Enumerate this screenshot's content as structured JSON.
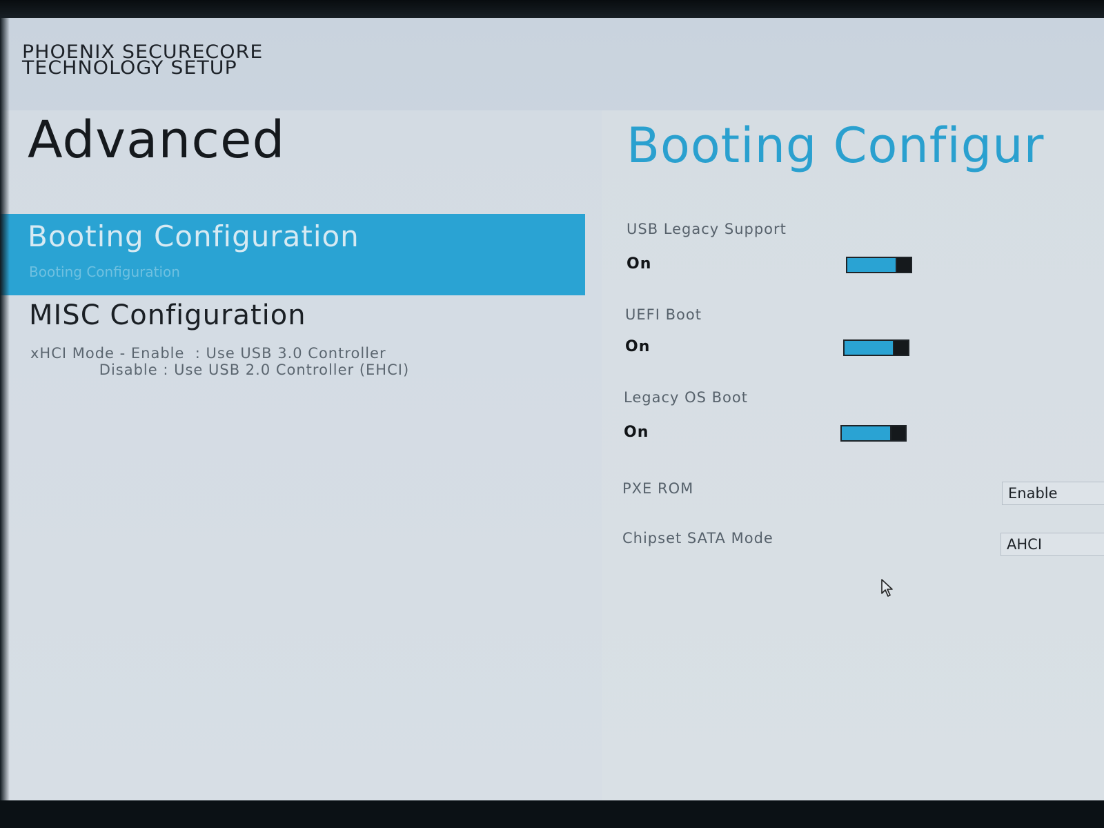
{
  "brand": {
    "line1": "PHOENIX SECURECORE",
    "line2": "TECHNOLOGY SETUP"
  },
  "page": {
    "title": "Advanced"
  },
  "nav": {
    "items": [
      {
        "label": "Booting Configuration",
        "sub": "Booting Configuration",
        "selected": true
      },
      {
        "label": "MISC Configuration",
        "desc_line1": "xHCI Mode - Enable  : Use USB 3.0 Controller",
        "desc_line2": "             Disable : Use USB 2.0 Controller (EHCI)",
        "selected": false
      }
    ]
  },
  "section": {
    "title": "Booting Configur"
  },
  "settings": {
    "usb_legacy": {
      "label": "USB Legacy Support",
      "value": "On"
    },
    "uefi_boot": {
      "label": "UEFI Boot",
      "value": "On"
    },
    "legacy_os_boot": {
      "label": "Legacy OS Boot",
      "value": "On"
    },
    "pxe_rom": {
      "label": "PXE ROM",
      "value": "Enable"
    },
    "sata_mode": {
      "label": "Chipset SATA Mode",
      "value": "AHCI"
    }
  },
  "colors": {
    "accent": "#2aa3d3",
    "background": "#d3dbe3",
    "title_text": "#15191d"
  },
  "icons": {
    "cursor": "mouse-pointer-icon"
  }
}
